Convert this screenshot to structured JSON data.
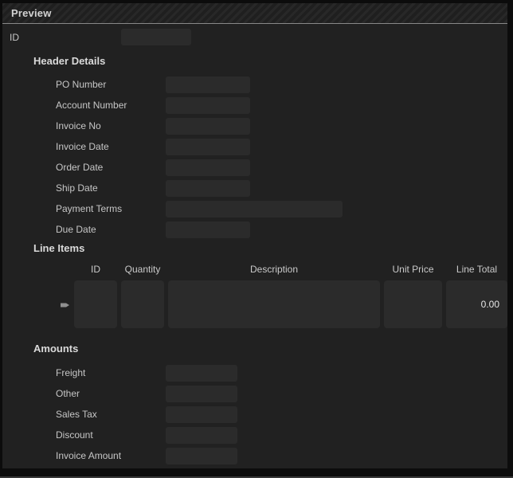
{
  "window": {
    "title": "Preview"
  },
  "id_field": {
    "label": "ID",
    "value": ""
  },
  "header_details": {
    "heading": "Header Details",
    "fields": [
      {
        "label": "PO Number",
        "value": ""
      },
      {
        "label": "Account Number",
        "value": ""
      },
      {
        "label": "Invoice No",
        "value": ""
      },
      {
        "label": "Invoice Date",
        "value": ""
      },
      {
        "label": "Order Date",
        "value": ""
      },
      {
        "label": "Ship Date",
        "value": ""
      },
      {
        "label": "Payment Terms",
        "value": ""
      },
      {
        "label": "Due Date",
        "value": ""
      }
    ]
  },
  "line_items": {
    "heading": "Line Items",
    "columns": [
      "ID",
      "Quantity",
      "Description",
      "Unit Price",
      "Line Total"
    ],
    "rows": [
      {
        "id": "",
        "quantity": "",
        "description": "",
        "unit_price": "",
        "line_total": "0.00"
      }
    ]
  },
  "amounts": {
    "heading": "Amounts",
    "fields": [
      {
        "label": "Freight",
        "value": ""
      },
      {
        "label": "Other",
        "value": ""
      },
      {
        "label": "Sales Tax",
        "value": ""
      },
      {
        "label": "Discount",
        "value": ""
      },
      {
        "label": "Invoice Amount",
        "value": ""
      }
    ]
  },
  "colors": {
    "window_background": "#212121",
    "field_background": "#2b2b2b",
    "border": "#0c0c0c",
    "label_text": "#c6c6c6",
    "heading_text": "#dadada",
    "titlebar_separator": "#888888",
    "row_selector": "#8f8f8f"
  }
}
